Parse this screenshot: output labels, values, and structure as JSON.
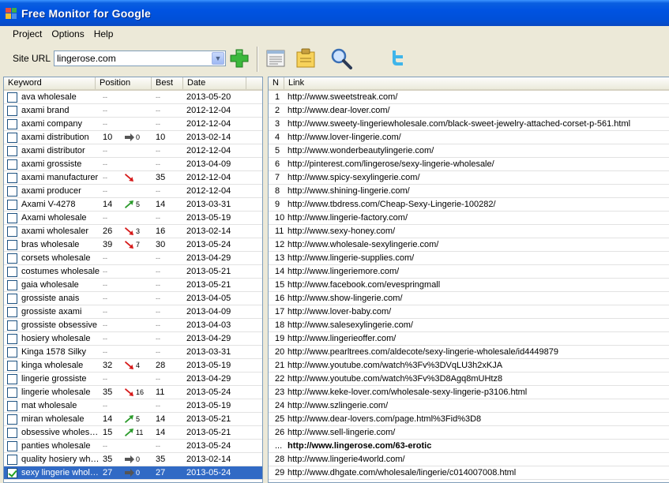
{
  "window": {
    "title": "Free Monitor for Google"
  },
  "menu": {
    "items": [
      "Project",
      "Options",
      "Help"
    ]
  },
  "toolbar": {
    "site_label": "Site URL",
    "site_value": "lingerose.com",
    "buttons": [
      "add-icon",
      "report-icon",
      "notes-icon",
      "search-icon",
      "twitter-icon"
    ]
  },
  "keywords": {
    "columns": [
      "Keyword",
      "Position",
      "Best",
      "Date"
    ],
    "rows": [
      {
        "keyword": "ava wholesale",
        "position": "--",
        "trend": "",
        "change": "",
        "best": "--",
        "date": "2013-05-20",
        "checked": false
      },
      {
        "keyword": "axami brand",
        "position": "--",
        "trend": "",
        "change": "",
        "best": "--",
        "date": "2012-12-04",
        "checked": false
      },
      {
        "keyword": "axami company",
        "position": "--",
        "trend": "",
        "change": "",
        "best": "--",
        "date": "2012-12-04",
        "checked": false
      },
      {
        "keyword": "axami distribution",
        "position": "10",
        "trend": "same",
        "change": "0",
        "best": "10",
        "date": "2013-02-14",
        "checked": false
      },
      {
        "keyword": "axami distributor",
        "position": "--",
        "trend": "",
        "change": "",
        "best": "--",
        "date": "2012-12-04",
        "checked": false
      },
      {
        "keyword": "axami grossiste",
        "position": "--",
        "trend": "",
        "change": "",
        "best": "--",
        "date": "2013-04-09",
        "checked": false
      },
      {
        "keyword": "axami manufacturer",
        "position": "--",
        "trend": "down",
        "change": "",
        "best": "35",
        "date": "2012-12-04",
        "checked": false
      },
      {
        "keyword": "axami producer",
        "position": "--",
        "trend": "",
        "change": "",
        "best": "--",
        "date": "2012-12-04",
        "checked": false
      },
      {
        "keyword": "Axami V-4278",
        "position": "14",
        "trend": "up",
        "change": "5",
        "best": "14",
        "date": "2013-03-31",
        "checked": false
      },
      {
        "keyword": "Axami wholesale",
        "position": "--",
        "trend": "",
        "change": "",
        "best": "--",
        "date": "2013-05-19",
        "checked": false
      },
      {
        "keyword": "axami wholesaler",
        "position": "26",
        "trend": "down",
        "change": "3",
        "best": "16",
        "date": "2013-02-14",
        "checked": false
      },
      {
        "keyword": "bras wholesale",
        "position": "39",
        "trend": "down",
        "change": "7",
        "best": "30",
        "date": "2013-05-24",
        "checked": false
      },
      {
        "keyword": "corsets wholesale",
        "position": "--",
        "trend": "",
        "change": "",
        "best": "--",
        "date": "2013-04-29",
        "checked": false
      },
      {
        "keyword": "costumes wholesale",
        "position": "--",
        "trend": "",
        "change": "",
        "best": "--",
        "date": "2013-05-21",
        "checked": false
      },
      {
        "keyword": "gaia wholesale",
        "position": "--",
        "trend": "",
        "change": "",
        "best": "--",
        "date": "2013-05-21",
        "checked": false
      },
      {
        "keyword": "grossiste anais",
        "position": "--",
        "trend": "",
        "change": "",
        "best": "--",
        "date": "2013-04-05",
        "checked": false
      },
      {
        "keyword": "grossiste axami",
        "position": "--",
        "trend": "",
        "change": "",
        "best": "--",
        "date": "2013-04-09",
        "checked": false
      },
      {
        "keyword": "grossiste obsessive",
        "position": "--",
        "trend": "",
        "change": "",
        "best": "--",
        "date": "2013-04-03",
        "checked": false
      },
      {
        "keyword": "hosiery wholesale",
        "position": "--",
        "trend": "",
        "change": "",
        "best": "--",
        "date": "2013-04-29",
        "checked": false
      },
      {
        "keyword": "Kinga 1578 Silky",
        "position": "--",
        "trend": "",
        "change": "",
        "best": "--",
        "date": "2013-03-31",
        "checked": false
      },
      {
        "keyword": "kinga wholesale",
        "position": "32",
        "trend": "down",
        "change": "4",
        "best": "28",
        "date": "2013-05-19",
        "checked": false
      },
      {
        "keyword": "lingerie grossiste",
        "position": "--",
        "trend": "",
        "change": "",
        "best": "--",
        "date": "2013-04-29",
        "checked": false
      },
      {
        "keyword": "lingerie wholesale",
        "position": "35",
        "trend": "down",
        "change": "16",
        "best": "11",
        "date": "2013-05-24",
        "checked": false
      },
      {
        "keyword": "mat wholesale",
        "position": "--",
        "trend": "",
        "change": "",
        "best": "--",
        "date": "2013-05-19",
        "checked": false
      },
      {
        "keyword": "miran wholesale",
        "position": "14",
        "trend": "up",
        "change": "5",
        "best": "14",
        "date": "2013-05-21",
        "checked": false
      },
      {
        "keyword": "obsessive wholesale",
        "position": "15",
        "trend": "up",
        "change": "11",
        "best": "14",
        "date": "2013-05-21",
        "checked": false
      },
      {
        "keyword": "panties wholesale",
        "position": "--",
        "trend": "",
        "change": "",
        "best": "--",
        "date": "2013-05-24",
        "checked": false
      },
      {
        "keyword": "quality hosiery wholesale",
        "position": "35",
        "trend": "same",
        "change": "0",
        "best": "35",
        "date": "2013-02-14",
        "checked": false
      },
      {
        "keyword": "sexy lingerie wholesale",
        "position": "27",
        "trend": "same",
        "change": "0",
        "best": "27",
        "date": "2013-05-24",
        "checked": true,
        "selected": true
      }
    ]
  },
  "links": {
    "columns": [
      "N",
      "Link"
    ],
    "rows": [
      {
        "n": "1",
        "url": "http://www.sweetstreak.com/"
      },
      {
        "n": "2",
        "url": "http://www.dear-lover.com/"
      },
      {
        "n": "3",
        "url": "http://www.sweety-lingeriewholesale.com/black-sweet-jewelry-attached-corset-p-561.html"
      },
      {
        "n": "4",
        "url": "http://www.lover-lingerie.com/"
      },
      {
        "n": "5",
        "url": "http://www.wonderbeautylingerie.com/"
      },
      {
        "n": "6",
        "url": "http://pinterest.com/lingerose/sexy-lingerie-wholesale/"
      },
      {
        "n": "7",
        "url": "http://www.spicy-sexylingerie.com/"
      },
      {
        "n": "8",
        "url": "http://www.shining-lingerie.com/"
      },
      {
        "n": "9",
        "url": "http://www.tbdress.com/Cheap-Sexy-Lingerie-100282/"
      },
      {
        "n": "10",
        "url": "http://www.lingerie-factory.com/"
      },
      {
        "n": "11",
        "url": "http://www.sexy-honey.com/"
      },
      {
        "n": "12",
        "url": "http://www.wholesale-sexylingerie.com/"
      },
      {
        "n": "13",
        "url": "http://www.lingerie-supplies.com/"
      },
      {
        "n": "14",
        "url": "http://www.lingeriemore.com/"
      },
      {
        "n": "15",
        "url": "http://www.facebook.com/evespringmall"
      },
      {
        "n": "16",
        "url": "http://www.show-lingerie.com/"
      },
      {
        "n": "17",
        "url": "http://www.lover-baby.com/"
      },
      {
        "n": "18",
        "url": "http://www.salesexylingerie.com/"
      },
      {
        "n": "19",
        "url": "http://www.lingerieoffer.com/"
      },
      {
        "n": "20",
        "url": "http://www.pearltrees.com/aldecote/sexy-lingerie-wholesale/id4449879"
      },
      {
        "n": "21",
        "url": "http://www.youtube.com/watch%3Fv%3DVqLU3h2xKJA"
      },
      {
        "n": "22",
        "url": "http://www.youtube.com/watch%3Fv%3D8Agq8mUHtz8"
      },
      {
        "n": "23",
        "url": "http://www.keke-lover.com/wholesale-sexy-lingerie-p3106.html"
      },
      {
        "n": "24",
        "url": "http://www.szlingerie.com/"
      },
      {
        "n": "25",
        "url": "http://www.dear-lovers.com/page.html%3Fid%3D8"
      },
      {
        "n": "26",
        "url": "http://www.sell-lingerie.com/"
      },
      {
        "n": "...",
        "url": "http://www.lingerose.com/63-erotic",
        "bold": true
      },
      {
        "n": "28",
        "url": "http://www.lingerie4world.com/"
      },
      {
        "n": "29",
        "url": "http://www.dhgate.com/wholesale/lingerie/c014007008.html"
      }
    ]
  },
  "colors": {
    "title_bar": "#0053e1",
    "selection": "#316ac5",
    "up_arrow": "#2a9a2a",
    "down_arrow": "#d61818",
    "same_arrow": "#555555"
  }
}
